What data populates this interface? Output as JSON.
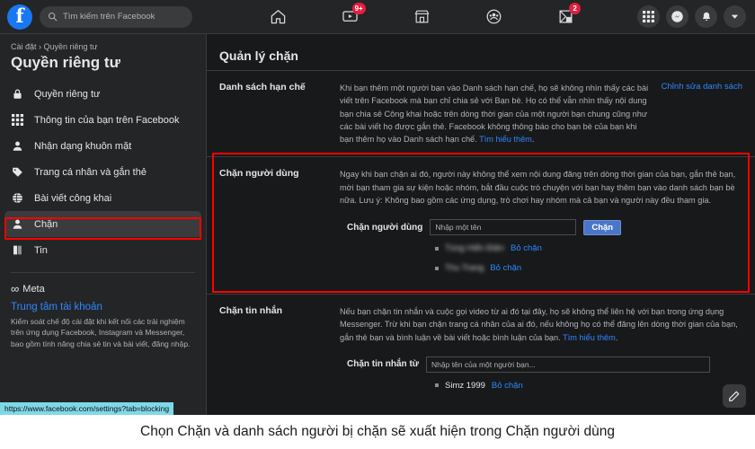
{
  "topbar": {
    "logo_letter": "f",
    "search": {
      "placeholder": "Tìm kiếm trên Facebook",
      "icon": "search-icon"
    },
    "nav": [
      {
        "name": "home-icon",
        "badge": ""
      },
      {
        "name": "video-icon",
        "badge": "9+"
      },
      {
        "name": "marketplace-icon",
        "badge": ""
      },
      {
        "name": "groups-icon",
        "badge": ""
      },
      {
        "name": "gaming-icon",
        "badge": "2"
      }
    ],
    "right": [
      {
        "name": "menu-grid-icon"
      },
      {
        "name": "messenger-icon"
      },
      {
        "name": "notifications-bell-icon"
      },
      {
        "name": "account-chevron-icon"
      }
    ]
  },
  "sidebar": {
    "breadcrumb": "Cài đặt › Quyền riêng tư",
    "title": "Quyền riêng tư",
    "items": [
      {
        "label": "Quyền riêng tư",
        "icon": "lock-icon",
        "active": false
      },
      {
        "label": "Thông tin của bạn trên Facebook",
        "icon": "grid-dots-icon",
        "active": false
      },
      {
        "label": "Nhận dạng khuôn mặt",
        "icon": "person-icon",
        "active": false
      },
      {
        "label": "Trang cá nhân và gắn thẻ",
        "icon": "tag-icon",
        "active": false
      },
      {
        "label": "Bài viết công khai",
        "icon": "globe-icon",
        "active": false
      },
      {
        "label": "Chặn",
        "icon": "person-block-icon",
        "active": true
      },
      {
        "label": "Tin",
        "icon": "book-icon",
        "active": false
      }
    ],
    "meta_brand": "Meta",
    "account_center_link": "Trung tâm tài khoản",
    "account_center_desc": "Kiểm soát chế độ cài đặt khi kết nối các trải nghiệm trên ứng dụng Facebook, Instagram và Messenger, bao gồm tính năng chia sẻ tin và bài viết, đăng nhập."
  },
  "main": {
    "header": "Quản lý chặn",
    "sections": [
      {
        "label": "Danh sách hạn chế",
        "text": "Khi bạn thêm một người bạn vào Danh sách hạn chế, họ sẽ không nhìn thấy các bài viết trên Facebook mà bạn chỉ chia sẻ với Bạn bè. Họ có thể vẫn nhìn thấy nội dung bạn chia sẻ Công khai hoặc trên dòng thời gian của một người bạn chung cũng như các bài viết họ được gắn thẻ. Facebook không thông báo cho bạn bè của bạn khi bạn thêm họ vào Danh sách hạn chế. ",
        "inline_link": "Tìm hiểu thêm",
        "action_link": "Chỉnh sửa danh sách"
      },
      {
        "label": "Chặn người dùng",
        "text": "Ngay khi bạn chặn ai đó, người này không thể xem nội dung đăng trên dòng thời gian của bạn, gắn thẻ bạn, mời bạn tham gia sự kiện hoặc nhóm, bắt đầu cuộc trò chuyện với bạn hay thêm bạn vào danh sách bạn bè nữa. Lưu ý: Không bao gồm các ứng dụng, trò chơi hay nhóm mà cả bạn và người này đều tham gia.",
        "inline_link": "",
        "action_link": "",
        "form": {
          "label": "Chặn người dùng",
          "placeholder": "Nhập một tên",
          "button": "Chặn"
        },
        "blocked": [
          {
            "name": "Tùng Hiển Điện",
            "blurred": true,
            "action": "Bỏ chặn"
          },
          {
            "name": "Thu Trang",
            "blurred": true,
            "action": "Bỏ chặn"
          }
        ]
      },
      {
        "label": "Chặn tin nhắn",
        "text": "Nếu bạn chặn tin nhắn và cuộc gọi video từ ai đó tại đây, họ sẽ không thể liên hệ với bạn trong ứng dụng Messenger. Trừ khi bạn chặn trang cá nhân của ai đó, nếu không họ có thể đăng lên dòng thời gian của bạn, gắn thẻ bạn và bình luận về bài viết hoặc bình luận của bạn. ",
        "inline_link": "Tìm hiểu thêm",
        "action_link": "",
        "form": {
          "label": "Chặn tin nhắn từ",
          "placeholder": "Nhập tên của một người bạn...",
          "button": ""
        },
        "blocked": [
          {
            "name": "Simz 1999",
            "blurred": false,
            "action": "Bỏ chặn"
          }
        ]
      }
    ],
    "fab_icon": "compose-icon"
  },
  "status_bar": {
    "url": "https://www.facebook.com/settings?tab=blocking"
  },
  "caption": "Chọn Chặn và danh sách người bị chặn sẽ xuất hiện trong Chặn người dùng",
  "colors": {
    "accent": "#2d88ff",
    "brand": "#1877f2",
    "annotation": "#ff0000",
    "badge": "#e41e3f"
  }
}
